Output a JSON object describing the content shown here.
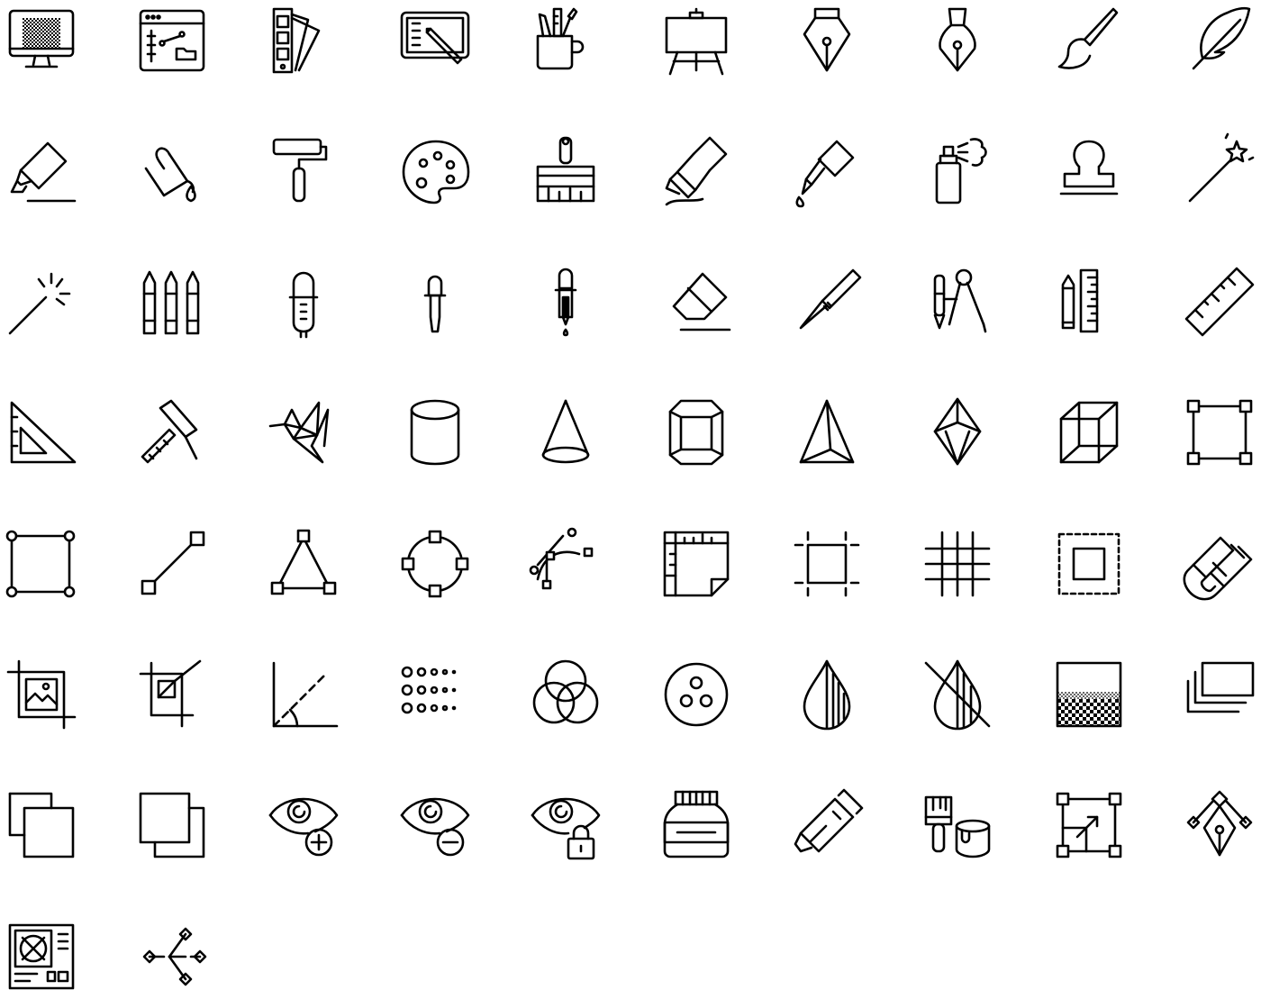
{
  "icon_set": {
    "stroke_color": "#000000",
    "background": "#ffffff",
    "icons": [
      "monitor-checker-icon",
      "design-app-window-icon",
      "color-swatches-icon",
      "drawing-tablet-icon",
      "pencil-cup-icon",
      "easel-icon",
      "fountain-pen-nib-icon",
      "calligraphy-nib-icon",
      "paint-brush-icon",
      "feather-quill-icon",
      "highlighter-icon",
      "paint-bucket-pour-icon",
      "paint-roller-icon",
      "paint-palette-icon",
      "wide-brush-icon",
      "paint-tube-icon",
      "glue-bottle-icon",
      "spray-can-icon",
      "rubber-stamp-icon",
      "magic-wand-star-icon",
      "magic-wand-sparkle-icon",
      "crayons-icon",
      "pipette-icon",
      "small-pipette-icon",
      "dropper-drip-icon",
      "eraser-icon",
      "craft-knife-icon",
      "pencil-compass-icon",
      "pencil-ruler-icon",
      "ruler-icon",
      "set-square-icon",
      "t-square-icon",
      "origami-bird-icon",
      "cylinder-icon",
      "cone-icon",
      "hexagonal-prism-icon",
      "pyramid-icon",
      "diamond-crystal-icon",
      "wireframe-cube-icon",
      "transform-box-icon",
      "circle-node-box-icon",
      "line-segment-icon",
      "triangle-nodes-icon",
      "circle-nodes-icon",
      "bezier-curve-icon",
      "rulers-corner-icon",
      "artboard-guides-icon",
      "grid-lines-icon",
      "marquee-selection-icon",
      "magnet-icon",
      "crop-image-icon",
      "crop-tool-icon",
      "angle-measure-icon",
      "halftone-dots-icon",
      "rgb-circles-icon",
      "color-channels-icon",
      "water-drop-icon",
      "no-water-drop-icon",
      "gradient-dither-icon",
      "layers-stack-icon",
      "overlap-front-icon",
      "overlap-back-icon",
      "eye-plus-icon",
      "eye-minus-icon",
      "eye-lock-icon",
      "ink-jar-icon",
      "marker-pen-icon",
      "brush-paint-can-icon",
      "scale-resize-icon",
      "pen-tool-anchors-icon",
      "blueprint-layout-icon",
      "vector-nodes-icon"
    ]
  }
}
